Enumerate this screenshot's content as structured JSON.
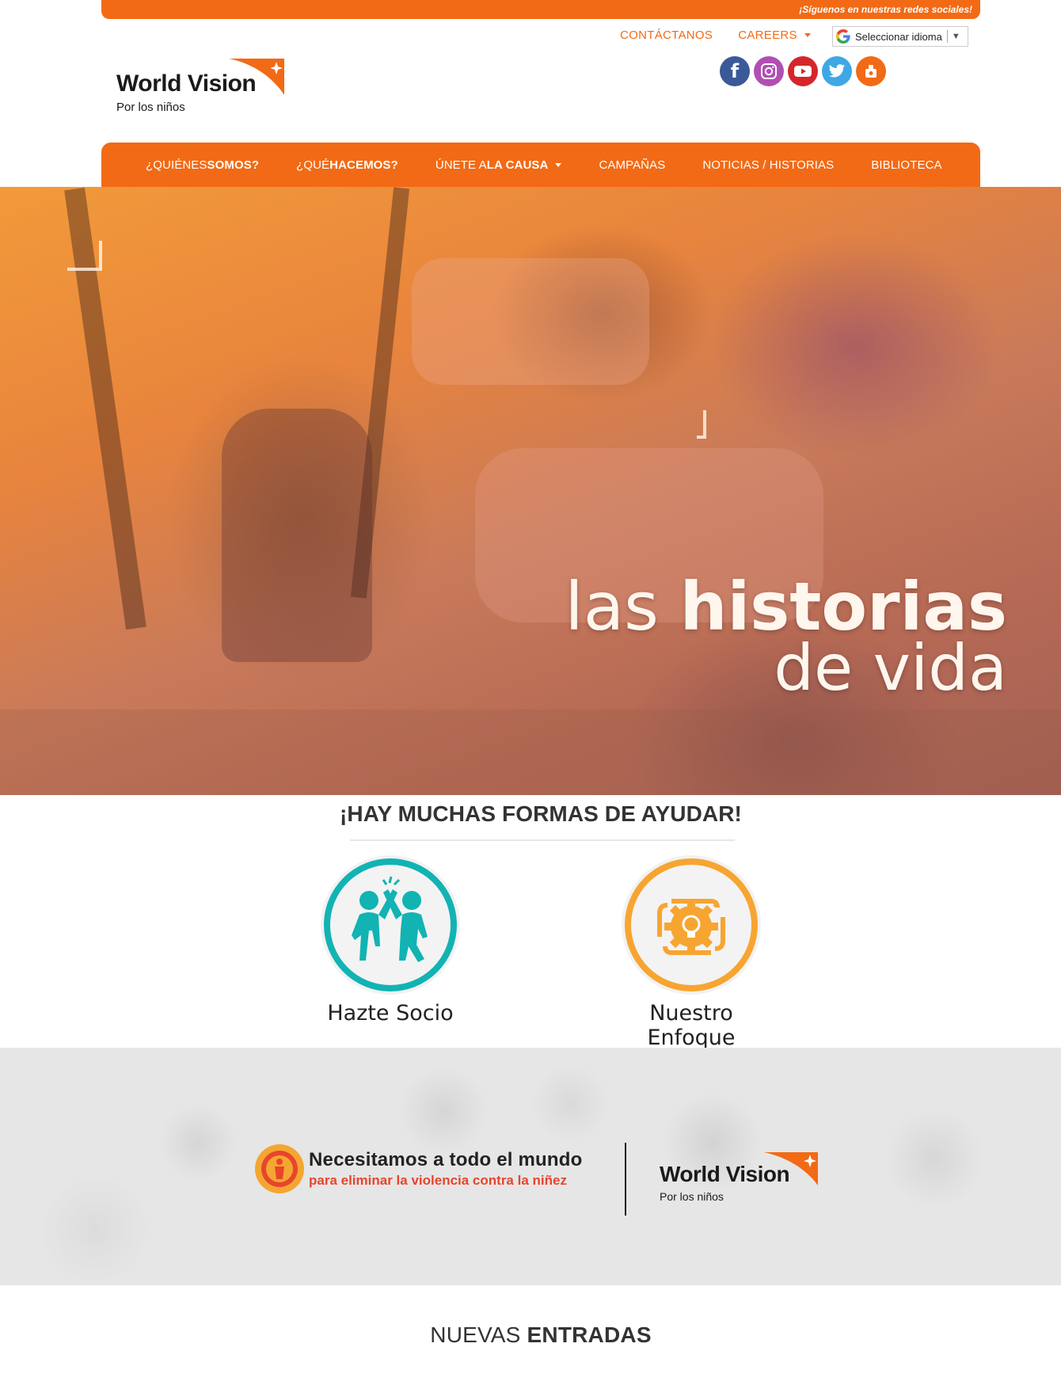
{
  "top_strip": {
    "text": "¡Síguenos en nuestras redes sociales!"
  },
  "utility": {
    "contact": "CONTÁCTANOS",
    "careers": "CAREERS",
    "language_select": "Seleccionar idioma"
  },
  "logo": {
    "name": "World Vision",
    "tagline": "Por los niños"
  },
  "socials": [
    "facebook-icon",
    "instagram-icon",
    "youtube-icon",
    "twitter-icon",
    "worldvision-icon"
  ],
  "nav": {
    "quienes_pre": "¿QUIÉNES ",
    "quienes_bold": "SOMOS?",
    "que_pre": "¿QUÉ ",
    "que_bold": "HACEMOS?",
    "unete_pre": "ÚNETE A ",
    "unete_bold": "LA CAUSA",
    "campanas": "CAMPAÑAS",
    "noticias": "NOTICIAS / HISTORIAS",
    "biblioteca": "BIBLIOTECA"
  },
  "hero": {
    "line1_light": "las ",
    "line1_bold": "historias",
    "line2": "de vida"
  },
  "help": {
    "title": "¡HAY MUCHAS FORMAS DE AYUDAR!",
    "cards": [
      {
        "label": "Hazte Socio",
        "icon": "high-five-kids-icon"
      },
      {
        "label": "Nuestro Enfoque",
        "icon": "gear-lightbulb-icon"
      }
    ]
  },
  "campaign": {
    "headline": "Necesitamos a todo el mundo",
    "subline": "para eliminar la violencia contra la niñez",
    "logo_name": "World Vision",
    "logo_tagline": "Por los niños"
  },
  "entries": {
    "title_light": "NUEVAS ",
    "title_bold": "ENTRADAS"
  },
  "colors": {
    "brand_orange": "#f26a15",
    "teal": "#12b3b3",
    "amber": "#f7a531"
  }
}
